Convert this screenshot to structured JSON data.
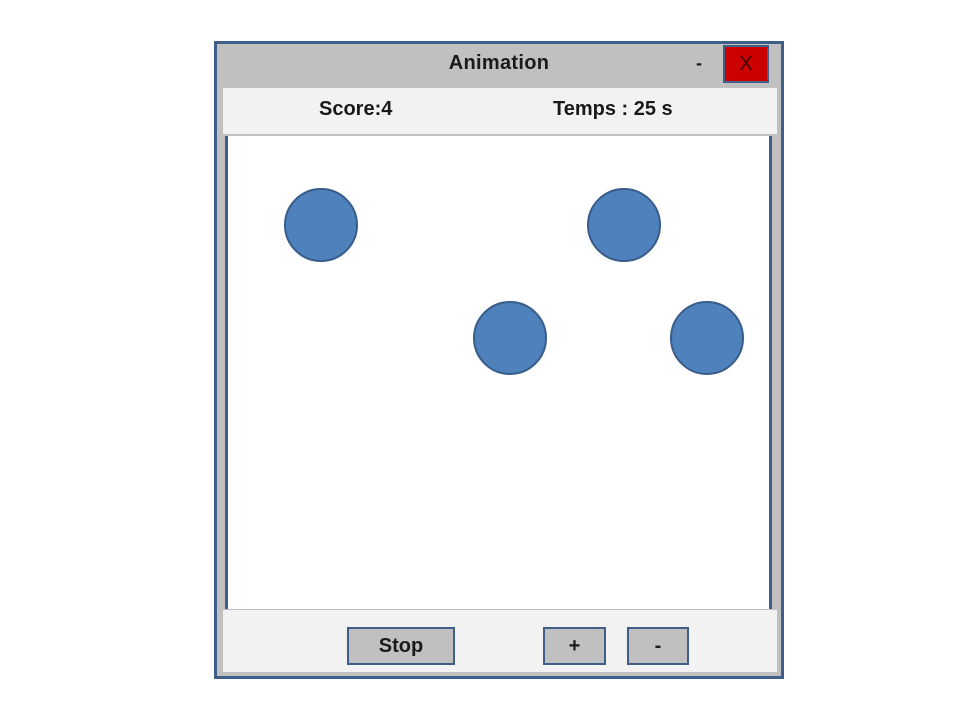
{
  "window": {
    "title": "Animation",
    "minimize_label": "-",
    "close_label": "X"
  },
  "info": {
    "score_text": "Score:4",
    "time_text": "Temps : 25 s"
  },
  "canvas": {
    "ball_color": "#4f81bd",
    "ball_border_color": "#385d8a",
    "ball_count": 4
  },
  "controls": {
    "stop_label": "Stop",
    "plus_label": "+",
    "minus_label": "-"
  },
  "colors": {
    "close_button": "#cc0000",
    "window_border": "#3f5f8a",
    "window_chrome": "#c0c0c0",
    "panel_background": "#f2f2f2"
  }
}
